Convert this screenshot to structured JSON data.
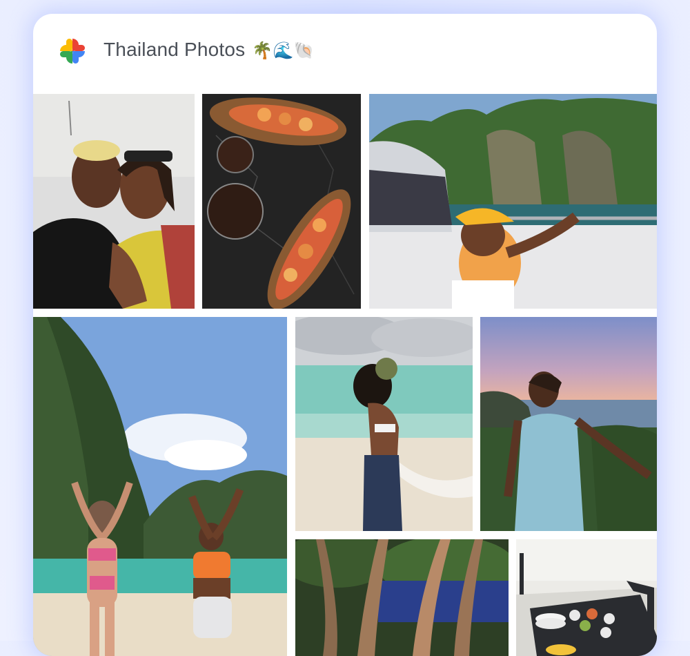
{
  "album": {
    "title": "Thailand Photos",
    "emoji": "🌴🌊🐚"
  },
  "icons": {
    "app_logo": "google-photos-pinwheel-icon"
  },
  "colors": {
    "logo_red": "#ea4335",
    "logo_yellow": "#fbbc04",
    "logo_green": "#34a853",
    "logo_blue": "#4285f4",
    "card_background": "#ffffff",
    "page_background": "#e7ecff"
  },
  "photos": [
    {
      "subject": "two-friends-selfie"
    },
    {
      "subject": "food-platters-on-marble-table"
    },
    {
      "subject": "woman-on-boat-with-cliffs"
    },
    {
      "subject": "two-women-dancing-on-beach"
    },
    {
      "subject": "woman-drinking-coconut-on-beach"
    },
    {
      "subject": "woman-in-blue-dress-at-sunset"
    },
    {
      "subject": "tree-trunks"
    },
    {
      "subject": "dining-table-on-terrace"
    }
  ]
}
